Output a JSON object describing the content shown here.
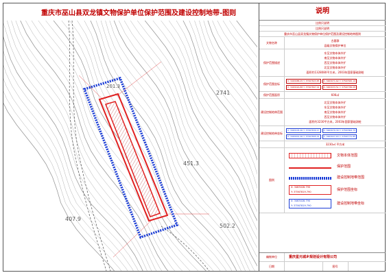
{
  "title": "重庆市巫山县双龙镇文物保护单位保护范围及建设控制地带-图则",
  "panel": {
    "heading": "说明",
    "notes": [
      "比例尺说明",
      "比例尺说明",
      "重庆市巫山县双龙镇文物保护单位保护范围及建设控制地带图则"
    ],
    "rows": [
      {
        "label": "文物名称",
        "lines": [
          "古墓群",
          "县级文物保护单位"
        ]
      },
      {
        "label": "保护范围描述",
        "lines": [
          "东至文物本体外扩",
          "南至文物本体外扩",
          "西至文物本体外扩",
          "北至文物本体外扩",
          "面积约1328080平方米，2003年国家基础测绘"
        ]
      },
      {
        "label": "保护范围坐标",
        "coords": [
          "X: 3463088.25 Y: 37567823.85",
          "X: 3463071.62 Y: 37567845.19",
          "X: 3463016.88 Y: 37567807.41",
          "X: 3463033.51 Y: 37567786.08"
        ]
      },
      {
        "label": "保护范围面积",
        "lines": [
          "606㎡"
        ]
      },
      {
        "label": "建设控制地带范围",
        "lines": [
          "北至文物本体外扩",
          "东至文物本体外扩",
          "南至文物本体外扩",
          "西至文物本体外扩",
          "面积约3230平方米，2003年国家基础测绘"
        ]
      },
      {
        "label": "建设控制地带坐标",
        "coords": [
          "X: 3463105.46 Y: 37567830.17",
          "X: 3463079.30 Y: 37567863.75",
          "X: 3463001.46 Y: 37567805.41",
          "X: 3463027.63 Y: 37567771.85"
        ],
        "blue": true
      },
      {
        "label": "",
        "lines": [
          "3230㎡ 平方米"
        ]
      }
    ],
    "legend_label": "图例",
    "legend": [
      {
        "sym": "red-box",
        "text": "文物本体范围"
      },
      {
        "sym": "red-line",
        "text": "保护范围"
      },
      {
        "sym": "blue-dot",
        "text": "建设控制地带范围"
      },
      {
        "sym": "coord-red",
        "text": "保护范围坐标",
        "x": "X: 3463028.790",
        "y": "Y: 37567819.790"
      },
      {
        "sym": "coord-blue",
        "text": "建设控制地带坐标",
        "x": "X: 3463028.790",
        "y": "Y: 37567819.790"
      }
    ],
    "footer": {
      "org_label": "编制单位",
      "org": "重庆星元城乡规划设计有限公司",
      "date_label": "日期",
      "date_value": "",
      "page_label": "图号",
      "page_value": ""
    }
  },
  "map": {
    "elevation_labels": [
      "2741",
      "451.3",
      "502.2",
      "407.9",
      "201.3"
    ],
    "colors": {
      "protection": "#e02020",
      "buffer": "#1a3cd6",
      "contour": "#9a9a9a",
      "body": "#e02020"
    }
  }
}
